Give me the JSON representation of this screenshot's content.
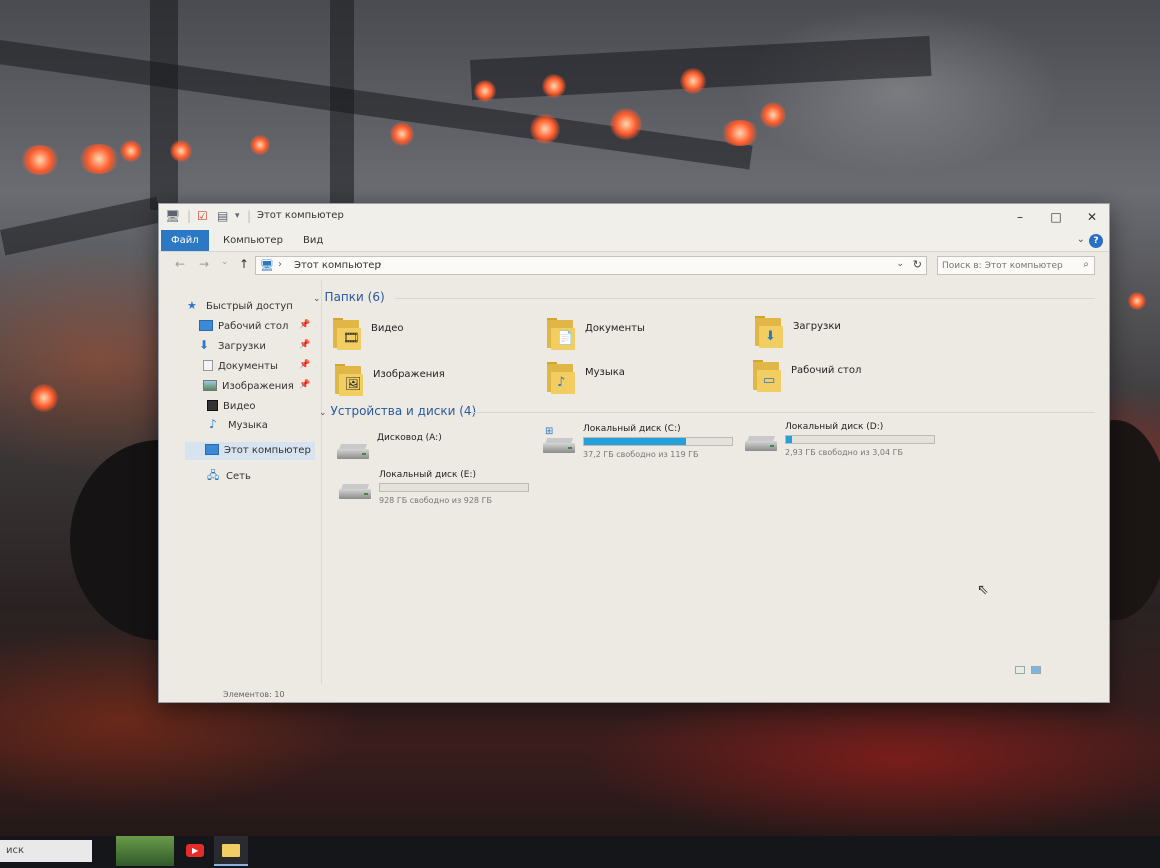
{
  "window": {
    "title": "Этот компьютер",
    "controls": {
      "minimize": "–",
      "maximize": "□",
      "close": "✕"
    }
  },
  "ribbon": {
    "tabs": [
      "Файл",
      "Компьютер",
      "Вид"
    ],
    "help": "?"
  },
  "address": {
    "location": "Этот компьютер",
    "separator": "›",
    "search_placeholder": "Поиск в: Этот компьютер"
  },
  "nav": {
    "items": [
      {
        "label": "Быстрый доступ",
        "icon": "star-icon",
        "pinned": false
      },
      {
        "label": "Рабочий стол",
        "icon": "desktop-icon",
        "pinned": true
      },
      {
        "label": "Загрузки",
        "icon": "download-icon",
        "pinned": true
      },
      {
        "label": "Документы",
        "icon": "document-icon",
        "pinned": true
      },
      {
        "label": "Изображения",
        "icon": "pictures-icon",
        "pinned": true
      },
      {
        "label": "Видео",
        "icon": "video-icon",
        "pinned": false
      },
      {
        "label": "Музыка",
        "icon": "music-icon",
        "pinned": false
      },
      {
        "label": "Этот компьютер",
        "icon": "computer-icon",
        "pinned": false,
        "selected": true
      },
      {
        "label": "Сеть",
        "icon": "network-icon",
        "pinned": false
      }
    ]
  },
  "folders": {
    "header": "Папки (6)",
    "items": [
      {
        "label": "Видео",
        "icon": "video-folder-icon"
      },
      {
        "label": "Документы",
        "icon": "documents-folder-icon"
      },
      {
        "label": "Загрузки",
        "icon": "downloads-folder-icon"
      },
      {
        "label": "Изображения",
        "icon": "pictures-folder-icon"
      },
      {
        "label": "Музыка",
        "icon": "music-folder-icon"
      },
      {
        "label": "Рабочий стол",
        "icon": "desktop-folder-icon"
      }
    ]
  },
  "devices": {
    "header": "Устройства и диски (4)",
    "items": [
      {
        "label": "Дисковод (A:)",
        "icon": "floppy-drive-icon",
        "free": "",
        "used_fraction": null
      },
      {
        "label": "Локальный диск (C:)",
        "icon": "windows-drive-icon",
        "free": "37,2 ГБ свободно из 119 ГБ",
        "used_fraction": 0.69
      },
      {
        "label": "Локальный диск (D:)",
        "icon": "hard-drive-icon",
        "free": "2,93 ГБ свободно из 3,04 ГБ",
        "used_fraction": 0.04
      },
      {
        "label": "Локальный диск (E:)",
        "icon": "hard-drive-icon",
        "free": "928 ГБ свободно из 928 ГБ",
        "used_fraction": 0.0
      }
    ]
  },
  "status": {
    "text": "Элементов: 10"
  },
  "taskbar": {
    "search_label": "иск"
  },
  "colors": {
    "accent": "#2b79c4",
    "bar_fill": "#26a0da",
    "folder": "#f1cd62"
  }
}
